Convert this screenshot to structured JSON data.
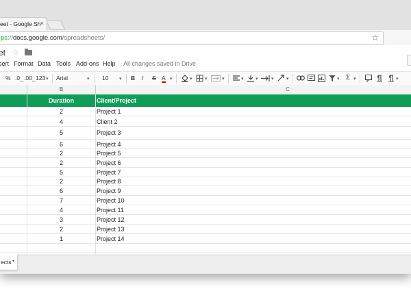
{
  "browser": {
    "tab_title": "eet - Google Sh",
    "tab_close": "×",
    "url_scheme": "ps",
    "url_sep": "://",
    "url_host": "docs.google.com",
    "url_path": "/spreadsheets/",
    "bookmark_star": "☆"
  },
  "docs": {
    "title": "et",
    "title_star": "☆",
    "menu": [
      "sert",
      "Format",
      "Data",
      "Tools",
      "Add-ons",
      "Help"
    ],
    "save_status": "All changes saved in Drive"
  },
  "format_toolbar": {
    "percent": "%",
    "decimal_less": ".0_",
    "decimal_more": ".00_",
    "number_format": "123",
    "font_family": "Arial",
    "font_size": "10",
    "bold": "B",
    "italic": "I",
    "strikethrough": "S",
    "text_color": "A",
    "functions": "Σ",
    "dropdown_arrow": "▾"
  },
  "columns": [
    "B",
    "C"
  ],
  "table": {
    "headers": [
      "Duration",
      "Client/Project"
    ],
    "rows": [
      [
        "2",
        "Project 1"
      ],
      [
        "4",
        "Client 2"
      ],
      [
        "5",
        "Project 3"
      ],
      [
        "6",
        "Project 4"
      ],
      [
        "2",
        "Project 5"
      ],
      [
        "2",
        "Project 6"
      ],
      [
        "5",
        "Project 7"
      ],
      [
        "2",
        "Project 8"
      ],
      [
        "6",
        "Project 9"
      ],
      [
        "7",
        "Project 10"
      ],
      [
        "4",
        "Project 11"
      ],
      [
        "3",
        "Project 12"
      ],
      [
        "2",
        "Project 13"
      ],
      [
        "1",
        "Project 14"
      ]
    ]
  },
  "sheet_tabs": {
    "active": "ects",
    "arrow": "▾"
  },
  "colors": {
    "header_fill": "#0f9d58",
    "url_scheme": "#1b9e3e",
    "text_color_underline": "#cc0000"
  }
}
